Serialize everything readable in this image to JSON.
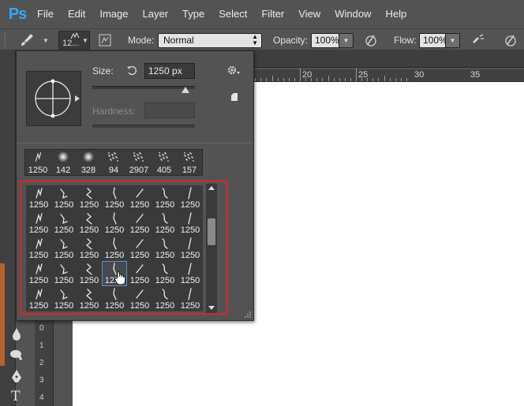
{
  "app": {
    "logo": "Ps"
  },
  "menu": [
    "File",
    "Edit",
    "Image",
    "Layer",
    "Type",
    "Select",
    "Filter",
    "View",
    "Window",
    "Help"
  ],
  "options_bar": {
    "brush_size_short": "12...",
    "mode_label": "Mode:",
    "mode_value": "Normal",
    "opacity_label": "Opacity:",
    "opacity_value": "100%",
    "flow_label": "Flow:",
    "flow_value": "100%"
  },
  "ruler": {
    "ticks": [
      "20",
      "25",
      "30",
      "35"
    ]
  },
  "vertical_ruler": [
    "0",
    "1",
    "2",
    "3",
    "4"
  ],
  "brush_panel": {
    "size_label": "Size:",
    "size_value": "1250 px",
    "hardness_label": "Hardness:",
    "size_slider_fraction": 0.91,
    "recent_brushes": [
      "1250",
      "142",
      "328",
      "94",
      "2907",
      "405",
      "157"
    ],
    "grid_rows": [
      [
        "1250",
        "1250",
        "1250",
        "1250",
        "1250",
        "1250",
        "1250"
      ],
      [
        "1250",
        "1250",
        "1250",
        "1250",
        "1250",
        "1250",
        "1250"
      ],
      [
        "1250",
        "1250",
        "1250",
        "1250",
        "1250",
        "1250",
        "1250"
      ],
      [
        "1250",
        "1250",
        "1250",
        "1250",
        "1250",
        "1250",
        "1250"
      ],
      [
        "1250",
        "1250",
        "1250",
        "1250",
        "1250",
        "1250",
        "1250"
      ]
    ],
    "selected_cell": {
      "row": 3,
      "col": 3
    },
    "highlight_color": "#d9242c"
  }
}
